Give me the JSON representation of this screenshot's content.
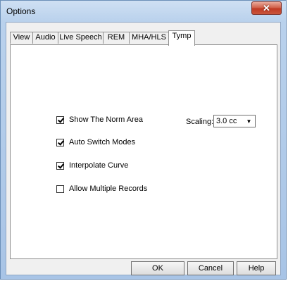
{
  "window": {
    "title": "Options",
    "close_icon": "close-icon"
  },
  "tabs": [
    {
      "label": "View",
      "active": false
    },
    {
      "label": "Audio",
      "active": false
    },
    {
      "label": "Live Speech",
      "active": false
    },
    {
      "label": "REM",
      "active": false
    },
    {
      "label": "MHA/HLS",
      "active": false
    },
    {
      "label": "Tymp",
      "active": true
    }
  ],
  "tymp": {
    "options": [
      {
        "label": "Show The Norm Area",
        "checked": true
      },
      {
        "label": "Auto Switch Modes",
        "checked": true
      },
      {
        "label": "Interpolate Curve",
        "checked": true
      },
      {
        "label": "Allow Multiple Records",
        "checked": false
      }
    ],
    "scaling_label": "Scaling:",
    "scaling_value": "3.0 cc"
  },
  "buttons": {
    "ok": "OK",
    "cancel": "Cancel",
    "help": "Help"
  }
}
